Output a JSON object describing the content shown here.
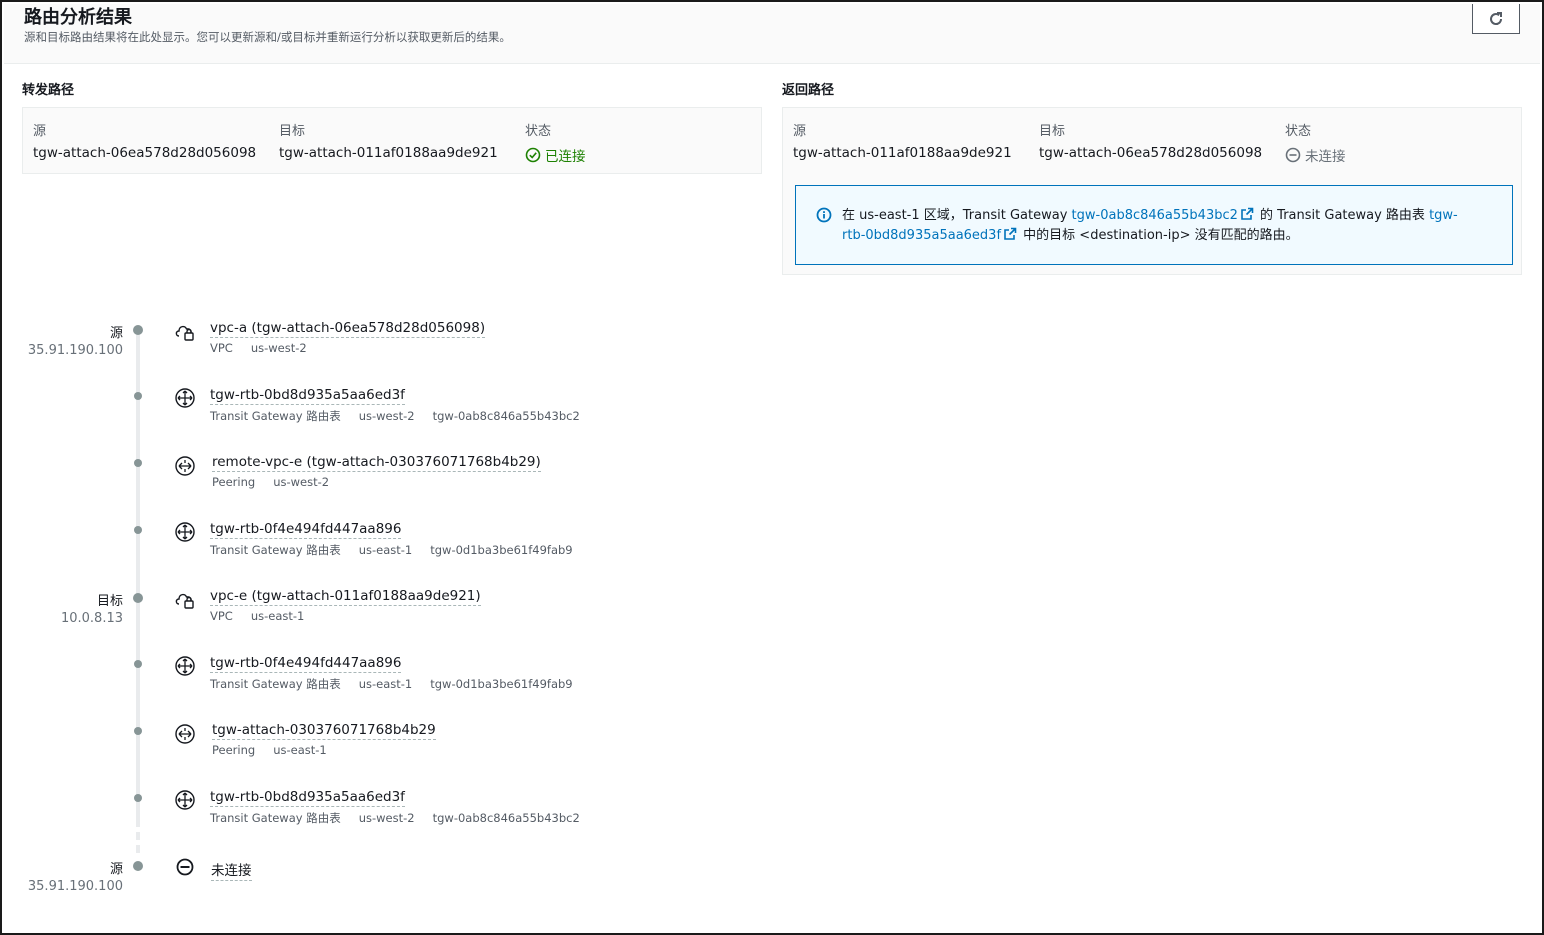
{
  "header": {
    "title": "路由分析结果",
    "description": "源和目标路由结果将在此处显示。您可以更新源和/或目标并重新运行分析以获取更新后的结果。",
    "refresh_icon": "refresh-icon"
  },
  "forward": {
    "title": "转发路径",
    "source_label": "源",
    "source_value": "tgw-attach-06ea578d28d056098",
    "target_label": "目标",
    "target_value": "tgw-attach-011af0188aa9de921",
    "status_label": "状态",
    "status_value": "已连接",
    "status_color": "#1d8102"
  },
  "return": {
    "title": "返回路径",
    "source_label": "源",
    "source_value": "tgw-attach-011af0188aa9de921",
    "target_label": "目标",
    "target_value": "tgw-attach-06ea578d28d056098",
    "status_label": "状态",
    "status_value": "未连接",
    "status_color": "#687078"
  },
  "alert": {
    "t1": "在 us-east-1 区域，Transit Gateway ",
    "link1": "tgw-0ab8c846a55b43bc2",
    "t2": " 的 Transit Gateway 路由表 ",
    "link2": "tgw-rtb-0bd8d935a5aa6ed3f",
    "t3": " 中的目标 <destination-ip> 没有匹配的路由。"
  },
  "timeline": {
    "source_label": "源",
    "source_ip": "35.91.190.100",
    "target_label": "目标",
    "target_ip": "10.0.8.13",
    "end_label": "源",
    "end_ip": "35.91.190.100",
    "nodes": [
      {
        "icon": "vpc-cloud-icon",
        "title": "vpc-a (tgw-attach-06ea578d28d056098)",
        "meta": [
          "VPC",
          "us-west-2"
        ]
      },
      {
        "icon": "route-table-icon",
        "title": "tgw-rtb-0bd8d935a5aa6ed3f",
        "meta": [
          "Transit Gateway 路由表",
          "us-west-2",
          "tgw-0ab8c846a55b43bc2"
        ]
      },
      {
        "icon": "peering-icon",
        "title": "remote-vpc-e (tgw-attach-030376071768b4b29)",
        "meta": [
          "Peering",
          "us-west-2"
        ]
      },
      {
        "icon": "route-table-icon",
        "title": "tgw-rtb-0f4e494fd447aa896",
        "meta": [
          "Transit Gateway 路由表",
          "us-east-1",
          "tgw-0d1ba3be61f49fab9"
        ]
      },
      {
        "icon": "vpc-cloud-icon",
        "title": "vpc-e (tgw-attach-011af0188aa9de921)",
        "meta": [
          "VPC",
          "us-east-1"
        ]
      },
      {
        "icon": "route-table-icon",
        "title": "tgw-rtb-0f4e494fd447aa896",
        "meta": [
          "Transit Gateway 路由表",
          "us-east-1",
          "tgw-0d1ba3be61f49fab9"
        ]
      },
      {
        "icon": "peering-icon",
        "title": "tgw-attach-030376071768b4b29",
        "meta": [
          "Peering",
          "us-east-1"
        ]
      },
      {
        "icon": "route-table-icon",
        "title": "tgw-rtb-0bd8d935a5aa6ed3f",
        "meta": [
          "Transit Gateway 路由表",
          "us-west-2",
          "tgw-0ab8c846a55b43bc2"
        ]
      },
      {
        "icon": "not-connected-icon",
        "title": "未连接",
        "meta": []
      }
    ]
  }
}
